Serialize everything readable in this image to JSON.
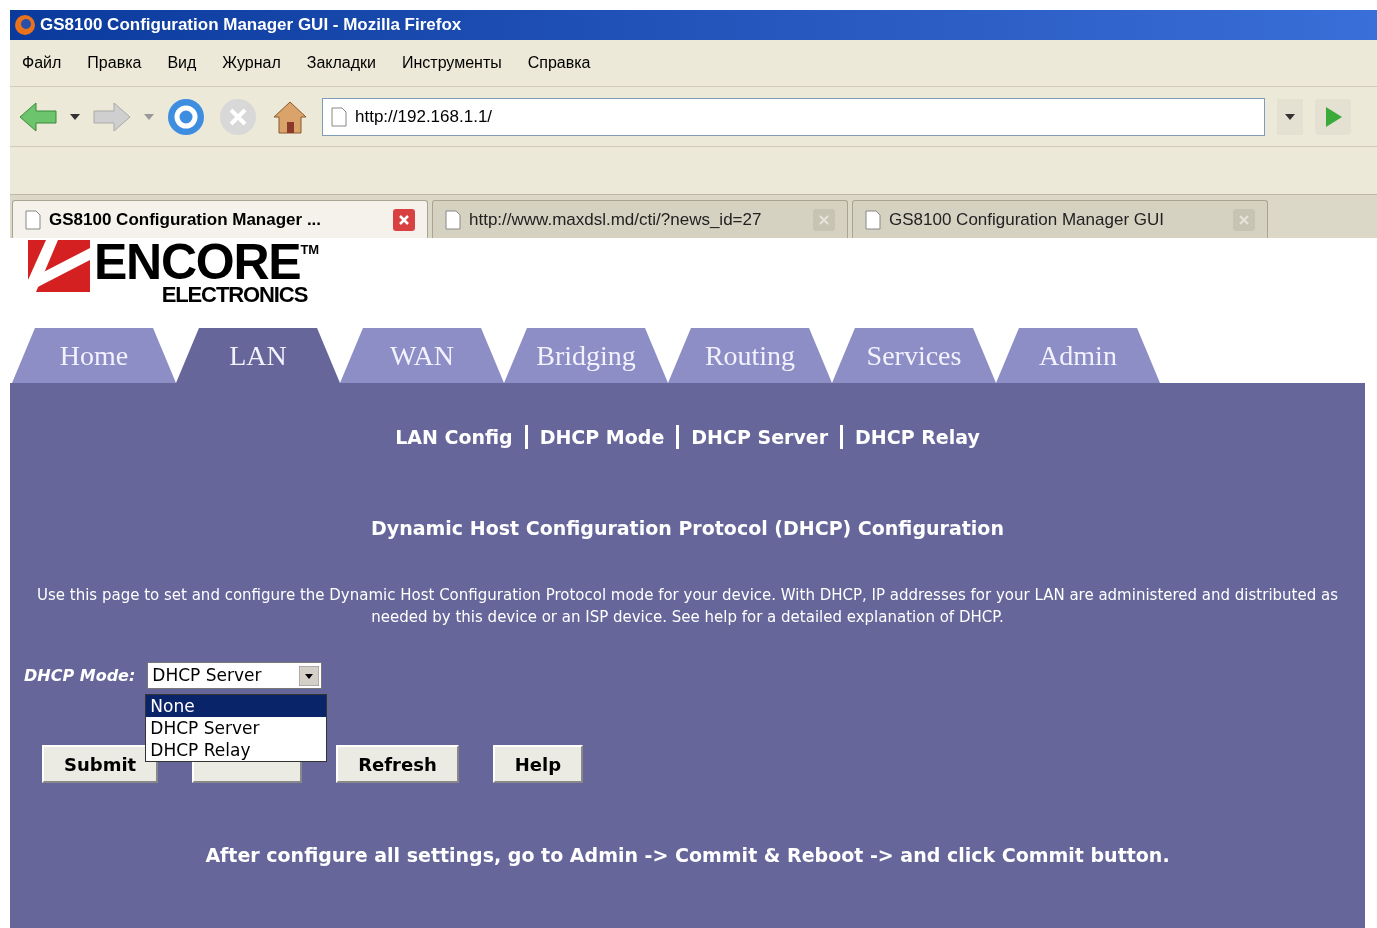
{
  "window": {
    "title": "GS8100 Configuration Manager GUI - Mozilla Firefox"
  },
  "menu": [
    "Файл",
    "Правка",
    "Вид",
    "Журнал",
    "Закладки",
    "Инструменты",
    "Справка"
  ],
  "address_bar": {
    "value": "http://192.168.1.1/"
  },
  "browser_tabs": [
    {
      "label": "GS8100 Configuration Manager ...",
      "selected": true
    },
    {
      "label": "http://www.maxdsl.md/cti/?news_id=27",
      "selected": false
    },
    {
      "label": "GS8100 Configuration Manager GUI",
      "selected": false
    }
  ],
  "logo": {
    "brand": "ENCORE",
    "trademark": "TM",
    "subtitle": "ELECTRONICS"
  },
  "nav_tabs": [
    {
      "label": "Home",
      "selected": false
    },
    {
      "label": "LAN",
      "selected": true
    },
    {
      "label": "WAN",
      "selected": false
    },
    {
      "label": "Bridging",
      "selected": false
    },
    {
      "label": "Routing",
      "selected": false
    },
    {
      "label": "Services",
      "selected": false
    },
    {
      "label": "Admin",
      "selected": false
    }
  ],
  "sub_nav": [
    "LAN Config",
    "DHCP Mode",
    "DHCP Server",
    "DHCP Relay"
  ],
  "heading": "Dynamic Host Configuration Protocol (DHCP) Configuration",
  "description": "Use this page to set and configure the Dynamic Host Configuration Protocol mode for your device. With DHCP, IP addresses for your LAN are administered and distributed as needed by this device or an ISP device. See help for a detailed explanation of DHCP.",
  "dhcp_mode": {
    "label": "DHCP Mode:",
    "value": "DHCP Server",
    "expanded": true,
    "options": [
      {
        "label": "None",
        "highlighted": true
      },
      {
        "label": "DHCP Server",
        "highlighted": false
      },
      {
        "label": "DHCP Relay",
        "highlighted": false
      }
    ]
  },
  "buttons": [
    {
      "kind": "labeled",
      "label": "Submit"
    },
    {
      "kind": "covered"
    },
    {
      "kind": "labeled",
      "label": "Refresh"
    },
    {
      "kind": "labeled",
      "label": "Help"
    }
  ],
  "footer_note": "After configure all settings, go to Admin -> Commit & Reboot -> and click Commit button."
}
